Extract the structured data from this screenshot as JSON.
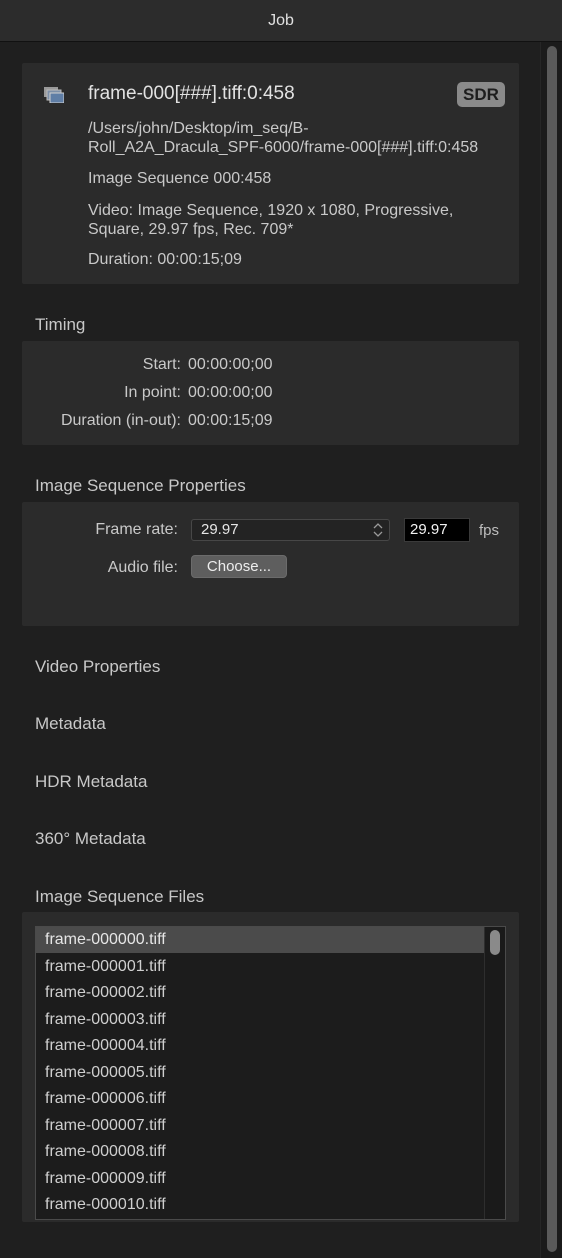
{
  "window": {
    "title": "Job"
  },
  "source": {
    "icon": "image-sequence-icon",
    "title": "frame-000[###].tiff:0:458",
    "badge": "SDR",
    "path_line1": "/Users/john/Desktop/im_seq/B-",
    "path_line2": "Roll_A2A_Dracula_SPF-6000/frame-000[###].tiff:0:458",
    "type": "Image Sequence 000:458",
    "video_line1": "Video: Image Sequence, 1920 x 1080, Progressive,",
    "video_line2": "Square, 29.97 fps, Rec. 709*",
    "duration": "Duration: 00:00:15;09"
  },
  "timing": {
    "heading": "Timing",
    "rows": [
      {
        "label": "Start:",
        "value": "00:00:00;00"
      },
      {
        "label": "In point:",
        "value": "00:00:00;00"
      },
      {
        "label": "Duration (in-out):",
        "value": "00:00:15;09"
      }
    ]
  },
  "image_sequence_properties": {
    "heading": "Image Sequence Properties",
    "frame_rate_label": "Frame rate:",
    "frame_rate_selected": "29.97",
    "frame_rate_value": "29.97",
    "fps_unit": "fps",
    "audio_file_label": "Audio file:",
    "choose_button": "Choose..."
  },
  "collapsed_sections": {
    "video_properties": "Video Properties",
    "metadata": "Metadata",
    "hdr_metadata": "HDR Metadata",
    "metadata_360": "360° Metadata"
  },
  "files": {
    "heading": "Image Sequence Files",
    "items": [
      "frame-000000.tiff",
      "frame-000001.tiff",
      "frame-000002.tiff",
      "frame-000003.tiff",
      "frame-000004.tiff",
      "frame-000005.tiff",
      "frame-000006.tiff",
      "frame-000007.tiff",
      "frame-000008.tiff",
      "frame-000009.tiff",
      "frame-000010.tiff"
    ],
    "selected_index": 0
  }
}
